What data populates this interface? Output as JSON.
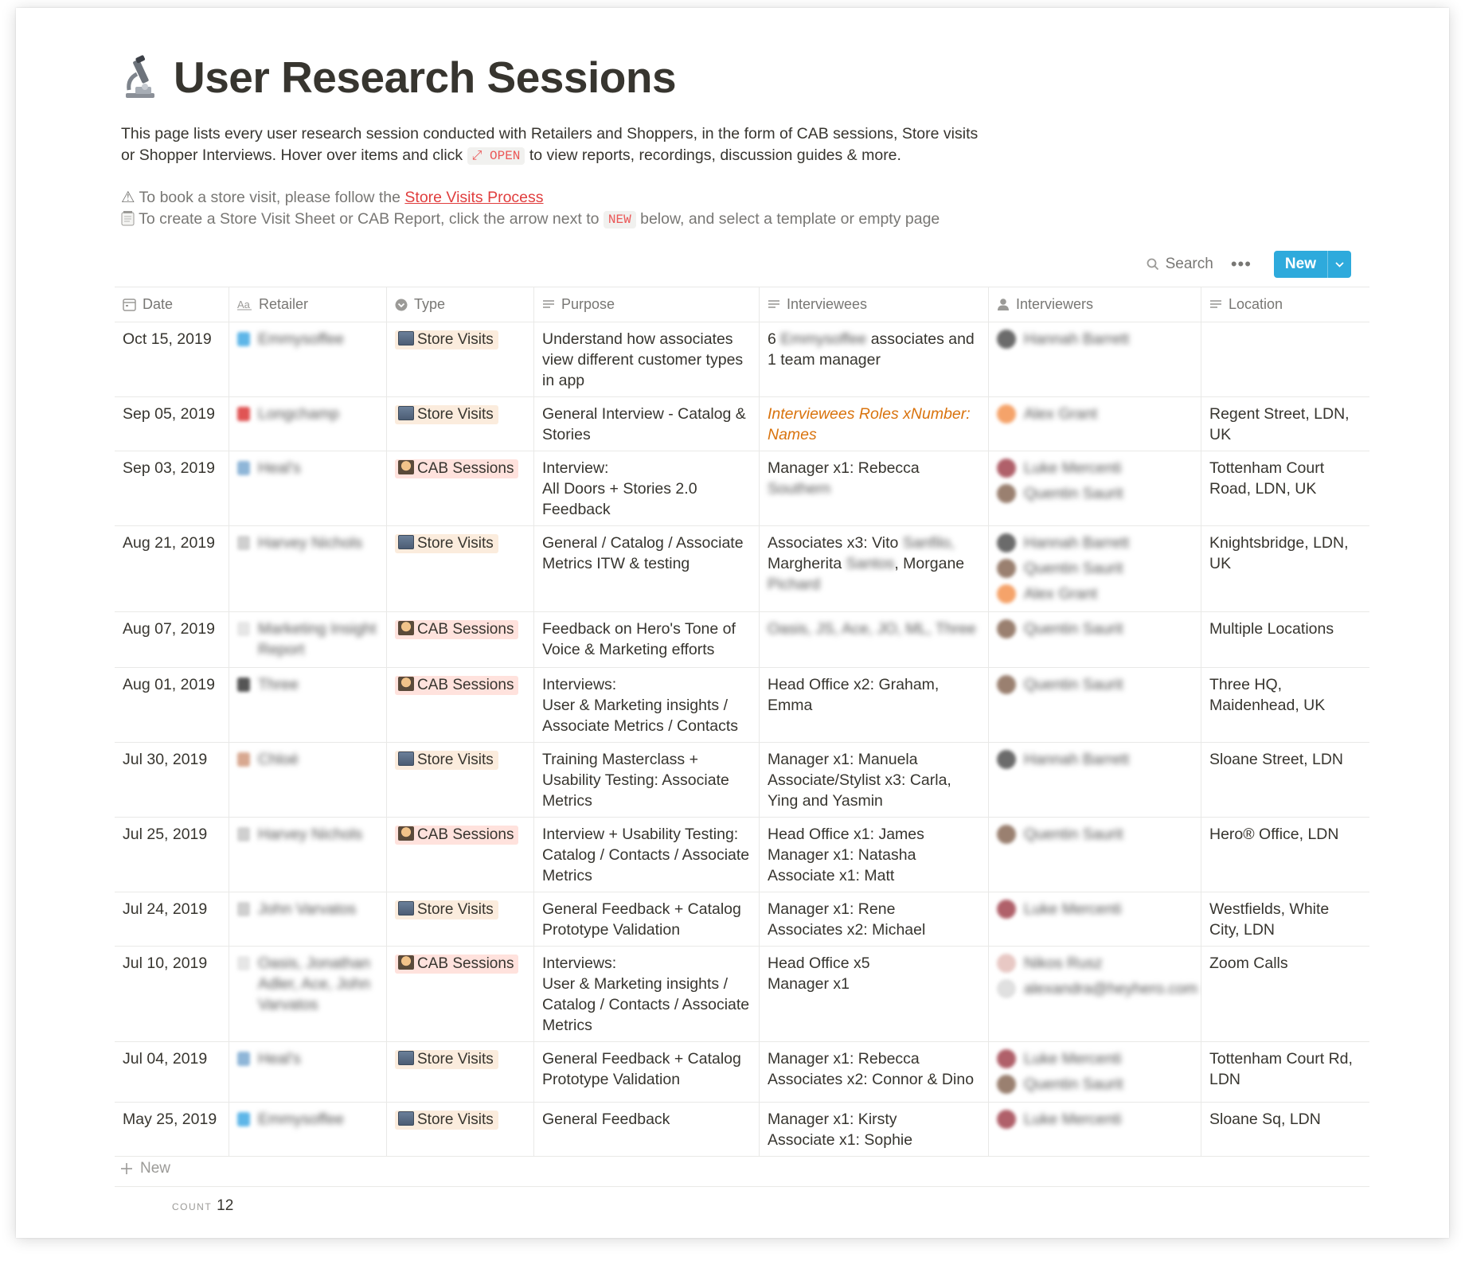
{
  "page": {
    "icon": "microscope-icon",
    "title": "User Research Sessions",
    "description_part1": "This page lists every user research session conducted with Retailers and Shoppers, in the form of CAB sessions, Store visits or Shopper Interviews. Hover over items and click ",
    "open_chip": "⤢ OPEN",
    "description_part2": " to view reports, recordings, discussion guides & more.",
    "note1_icon": "⚠",
    "note1_text": " To book a store visit, please follow the ",
    "note1_link": "Store Visits Process",
    "note2_icon": "notepad-icon",
    "note2_text_a": " To create a Store Visit Sheet or CAB Report, click the arrow next to ",
    "new_chip": "NEW",
    "note2_text_b": " below, and select a template or empty page"
  },
  "toolbar": {
    "search_label": "Search",
    "more_label": "•••",
    "new_label": "New"
  },
  "columns": {
    "date": "Date",
    "retailer": "Retailer",
    "type": "Type",
    "purpose": "Purpose",
    "interviewees": "Interviewees",
    "interviewers": "Interviewers",
    "location": "Location"
  },
  "types": {
    "store": "Store Visits",
    "cab": "CAB Sessions"
  },
  "colors": {
    "accent_blue": "#2eaadc",
    "store_tag_bg": "#fbecdd",
    "cab_tag_bg": "#ffe2dd",
    "link_red": "#e03e3e",
    "orange_text": "#d9730d"
  },
  "rows": [
    {
      "date": "Oct 15, 2019",
      "retailer": "Emmysoffee",
      "type": "store",
      "purpose": "Understand how associates view different customer types in app",
      "interviewees_a": "6 ",
      "interviewees_blur": "Emmysoffee",
      "interviewees_b": " associates and 1 team manager",
      "interviewers": [
        "Hannah Barrett"
      ],
      "location": ""
    },
    {
      "date": "Sep 05, 2019",
      "retailer": "Longchamp",
      "type": "store",
      "purpose": "General Interview - Catalog & Stories",
      "interviewees": "Interviewees Roles xNumber: Names",
      "interviewers": [
        "Alex Grant"
      ],
      "location": "Regent Street, LDN, UK"
    },
    {
      "date": "Sep 03, 2019",
      "retailer": "Heal's",
      "type": "cab",
      "purpose_l1": "Interview:",
      "purpose_l2": "All Doors + Stories 2.0 Feedback",
      "interviewees_a": "Manager x1: Rebecca ",
      "interviewees_blur": "Southern",
      "interviewers": [
        "Luke Mercenti",
        "Quentin Saurit"
      ],
      "location": "Tottenham Court Road, LDN, UK"
    },
    {
      "date": "Aug 21, 2019",
      "retailer": "Harvey Nichols",
      "type": "store",
      "purpose": "General / Catalog / Associate Metrics ITW & testing",
      "interviewees_a": "Associates x3: Vito ",
      "interviewees_blur": "Sanfilo,",
      "interviewees_b": " Margherita ",
      "interviewees_blur2": "Santos",
      "interviewees_c": ", Morgane ",
      "interviewees_blur3": "Pichard",
      "interviewers": [
        "Hannah Barrett",
        "Quentin Saurit",
        "Alex Grant"
      ],
      "location": "Knightsbridge, LDN, UK"
    },
    {
      "date": "Aug 07, 2019",
      "retailer": "Marketing Insight Report",
      "type": "cab",
      "purpose": "Feedback on Hero's Tone of Voice & Marketing efforts",
      "interviewees_blur": "Oasis, JS, Ace, JO, ML, Three",
      "interviewers": [
        "Quentin Saurit"
      ],
      "location": "Multiple Locations"
    },
    {
      "date": "Aug 01, 2019",
      "retailer": "Three",
      "type": "cab",
      "purpose_l1": "Interviews:",
      "purpose_l2": "User & Marketing insights / Associate Metrics / Contacts",
      "interviewees": "Head Office x2: Graham, Emma",
      "interviewers": [
        "Quentin Saurit"
      ],
      "location": "Three HQ, Maidenhead, UK"
    },
    {
      "date": "Jul 30, 2019",
      "retailer": "Chloé",
      "type": "store",
      "purpose_l1": "Training Masterclass +",
      "purpose_l2": "Usability Testing: Associate Metrics",
      "interviewees_l1": "Manager x1: Manuela",
      "interviewees_l2": "Associate/Stylist x3: Carla, Ying and Yasmin",
      "interviewers": [
        "Hannah Barrett"
      ],
      "location": "Sloane Street, LDN"
    },
    {
      "date": "Jul 25, 2019",
      "retailer": "Harvey Nichols",
      "type": "cab",
      "purpose": "Interview + Usability Testing: Catalog / Contacts / Associate Metrics",
      "interviewees_l1": "Head Office x1: James",
      "interviewees_l2": "Manager x1: Natasha",
      "interviewees_l3": "Associate x1: Matt",
      "interviewers": [
        "Quentin Saurit"
      ],
      "location": "Hero® Office, LDN"
    },
    {
      "date": "Jul 24, 2019",
      "retailer": "John Varvatos",
      "type": "store",
      "purpose": "General Feedback + Catalog Prototype Validation",
      "interviewees_l1": "Manager x1: Rene",
      "interviewees_l2": "Associates x2: Michael",
      "interviewers": [
        "Luke Mercenti"
      ],
      "location": "Westfields, White City, LDN"
    },
    {
      "date": "Jul 10, 2019",
      "retailer": "Oasis, Jonathan Adler, Ace, John Varvatos",
      "type": "cab",
      "purpose_l1": "Interviews:",
      "purpose_l2": "User & Marketing insights / Catalog / Contacts / Associate Metrics",
      "interviewees_l1": "Head Office x5",
      "interviewees_l2": "Manager x1",
      "interviewers": [
        "Nikos Rusz",
        "alexandra@heyhero.com"
      ],
      "location": "Zoom Calls"
    },
    {
      "date": "Jul 04, 2019",
      "retailer": "Heal's",
      "type": "store",
      "purpose": "General Feedback + Catalog Prototype Validation",
      "interviewees_l1": "Manager x1: Rebecca",
      "interviewees_l2": "Associates x2: Connor & Dino",
      "interviewers": [
        "Luke Mercenti",
        "Quentin Saurit"
      ],
      "location": "Tottenham Court Rd, LDN"
    },
    {
      "date": "May 25, 2019",
      "retailer": "Emmysoffee",
      "type": "store",
      "purpose": "General Feedback",
      "interviewees_l1": "Manager x1: Kirsty",
      "interviewees_l2": "Associate x1: Sophie",
      "interviewers": [
        "Luke Mercenti"
      ],
      "location": "Sloane Sq, LDN"
    }
  ],
  "footer": {
    "add_label": "New",
    "count_label": "COUNT",
    "count_value": "12"
  }
}
